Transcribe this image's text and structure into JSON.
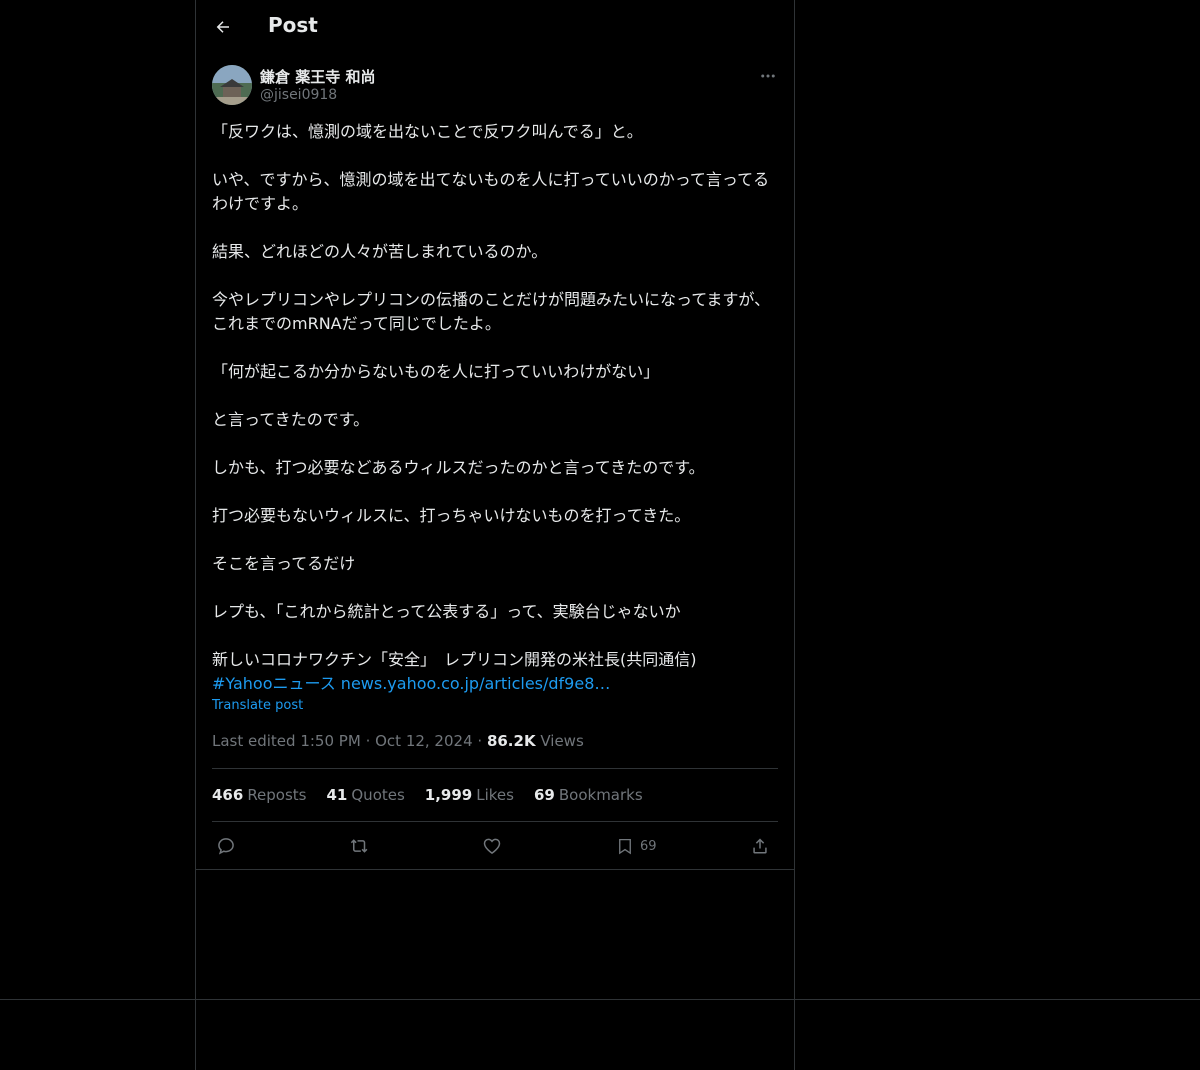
{
  "header": {
    "title": "Post"
  },
  "author": {
    "display_name": "鎌倉 薬王寺 和尚",
    "handle": "@jisei0918"
  },
  "post": {
    "paragraphs": [
      "「反ワクは、憶測の域を出ないことで反ワク叫んでる」と。",
      "いや、ですから、憶測の域を出てないものを人に打っていいのかって言ってるわけですよ。",
      "結果、どれほどの人々が苦しまれているのか。",
      "今やレプリコンやレプリコンの伝播のことだけが問題みたいになってますが、これまでのmRNAだって同じでしたよ。",
      "「何が起こるか分からないものを人に打っていいわけがない」",
      "と言ってきたのです。",
      "しかも、打つ必要などあるウィルスだったのかと言ってきたのです。",
      "打つ必要もないウィルスに、打っちゃいけないものを打ってきた。",
      "そこを言ってるだけ",
      "レプも、「これから統計とって公表する」って、実験台じゃないか"
    ],
    "news_headline": "新しいコロナワクチン「安全」　レプリコン開発の米社長(共同通信)",
    "hashtag": "#Yahooニュース",
    "link": "news.yahoo.co.jp/articles/df9e8…",
    "translate_label": "Translate post",
    "edited": "Last edited 1:50 PM",
    "date": "Oct 12, 2024",
    "views_count": "86.2K",
    "views_label": "Views"
  },
  "stats": {
    "reposts_count": "466",
    "reposts_label": "Reposts",
    "quotes_count": "41",
    "quotes_label": "Quotes",
    "likes_count": "1,999",
    "likes_label": "Likes",
    "bookmarks_count": "69",
    "bookmarks_label": "Bookmarks"
  },
  "actions": {
    "bookmark_count": "69"
  },
  "icons": [
    "back-arrow-icon",
    "more-icon",
    "reply-icon",
    "repost-icon",
    "like-icon",
    "bookmark-icon",
    "share-icon"
  ]
}
